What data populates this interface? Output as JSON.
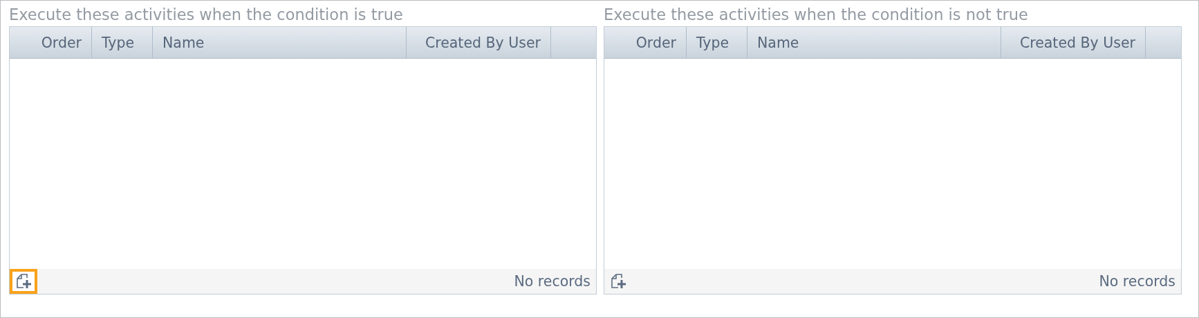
{
  "panels": [
    {
      "title": "Execute these activities when the condition is true",
      "columns": [
        "Order",
        "Type",
        "Name",
        "Created By User"
      ],
      "add_button": {
        "highlighted": true
      },
      "status": "No records"
    },
    {
      "title": "Execute these activities when the condition is not true",
      "columns": [
        "Order",
        "Type",
        "Name",
        "Created By User"
      ],
      "add_button": {
        "highlighted": false
      },
      "status": "No records"
    }
  ]
}
